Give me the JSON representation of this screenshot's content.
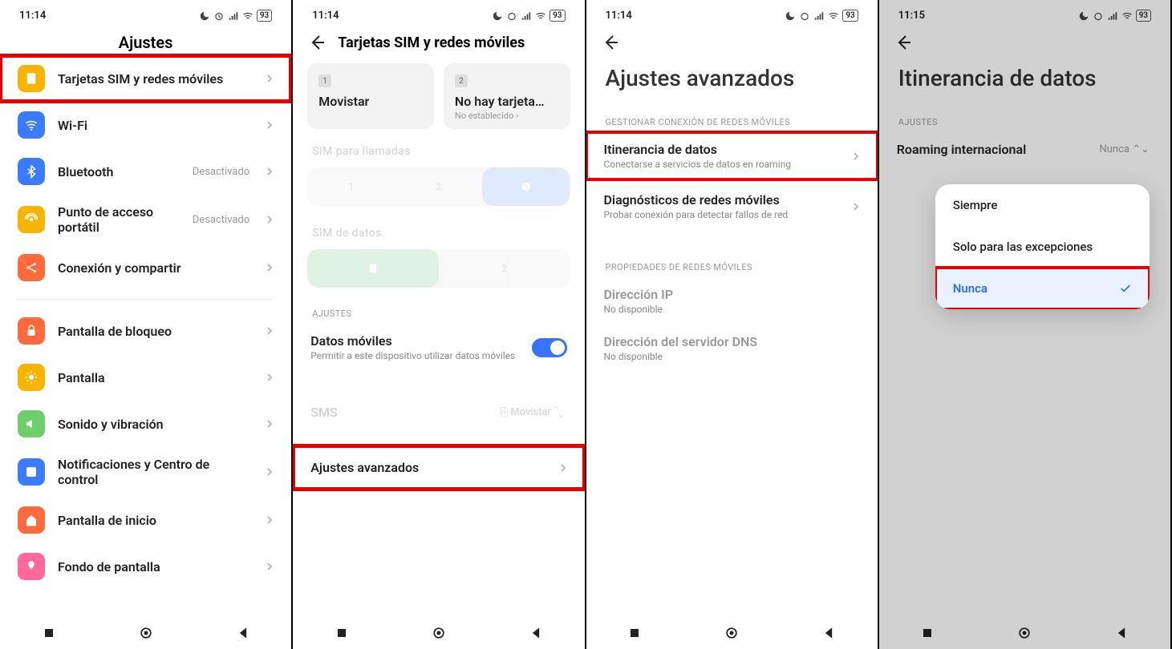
{
  "status": {
    "time_a": "11:14",
    "time_b": "11:15",
    "battery": "93"
  },
  "s1": {
    "title": "Ajustes",
    "items": [
      {
        "label": "Tarjetas SIM y redes móviles",
        "color": "#f7b500"
      },
      {
        "label": "Wi-Fi",
        "color": "#3a7bff"
      },
      {
        "label": "Bluetooth",
        "right": "Desactivado",
        "color": "#3a7bff"
      },
      {
        "label": "Punto de acceso portátil",
        "right": "Desactivado",
        "color": "#f7b500"
      },
      {
        "label": "Conexión y compartir",
        "color": "#ff6a3d"
      },
      {
        "label": "Pantalla de bloqueo",
        "color": "#ff6a3d"
      },
      {
        "label": "Pantalla",
        "color": "#f7b500"
      },
      {
        "label": "Sonido y vibración",
        "color": "#6ccf6c"
      },
      {
        "label": "Notificaciones y Centro de control",
        "color": "#3a7bff"
      },
      {
        "label": "Pantalla de inicio",
        "color": "#ff6a3d"
      },
      {
        "label": "Fondo de pantalla",
        "color": "#ff6a9a"
      }
    ]
  },
  "s2": {
    "title": "Tarjetas SIM y redes móviles",
    "sim1": {
      "badge": "1",
      "name": "Movistar"
    },
    "sim2": {
      "badge": "2",
      "name": "No hay tarjeta…",
      "sub": "No establecido"
    },
    "sec_calls": "SIM para llamadas",
    "sec_data": "SIM de datos",
    "sec_ajustes": "AJUSTES",
    "mobile_data": {
      "title": "Datos móviles",
      "sub": "Permitir a este dispositivo utilizar datos móviles"
    },
    "sms_row": {
      "label": "SMS",
      "value": "Movistar"
    },
    "advanced": "Ajustes avanzados"
  },
  "s3": {
    "title": "Ajustes avanzados",
    "sec_manage": "GESTIONAR CONEXIÓN DE REDES MÓVILES",
    "roaming": {
      "title": "Itinerancia de datos",
      "sub": "Conectarse a servicios de datos en roaming"
    },
    "diag": {
      "title": "Diagnósticos de redes móviles",
      "sub": "Probar conexión para detectar fallos de red"
    },
    "sec_props": "PROPIEDADES DE REDES MÓVILES",
    "ip": {
      "title": "Dirección IP",
      "sub": "No disponible"
    },
    "dns": {
      "title": "Dirección del servidor DNS",
      "sub": "No disponible"
    }
  },
  "s4": {
    "title": "Itinerancia de datos",
    "sec": "AJUSTES",
    "intl": {
      "label": "Roaming internacional",
      "value": "Nunca"
    },
    "opts": [
      "Siempre",
      "Solo para las excepciones",
      "Nunca"
    ]
  }
}
